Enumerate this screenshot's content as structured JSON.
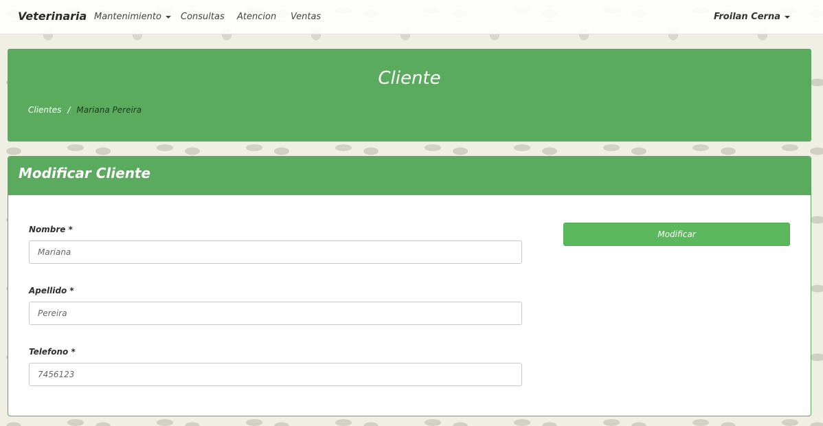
{
  "navbar": {
    "brand": "Veterinaria",
    "items": [
      {
        "label": "Mantenimiento",
        "dropdown": true
      },
      {
        "label": "Consultas"
      },
      {
        "label": "Atencion"
      },
      {
        "label": "Ventas"
      }
    ],
    "user": "Froilan Cerna"
  },
  "header": {
    "title": "Cliente",
    "breadcrumb": {
      "parent": "Clientes",
      "separator": "/",
      "current": "Mariana Pereira"
    }
  },
  "form": {
    "heading": "Modificar Cliente",
    "fields": [
      {
        "label": "Nombre *",
        "value": "Mariana"
      },
      {
        "label": "Apellido *",
        "value": "Pereira"
      },
      {
        "label": "Telefono *",
        "value": "7456123"
      }
    ],
    "submit_label": "Modificar"
  },
  "colors": {
    "primary_green": "#5bab5f",
    "button_green": "#5cb85c",
    "background": "#efefe3"
  }
}
